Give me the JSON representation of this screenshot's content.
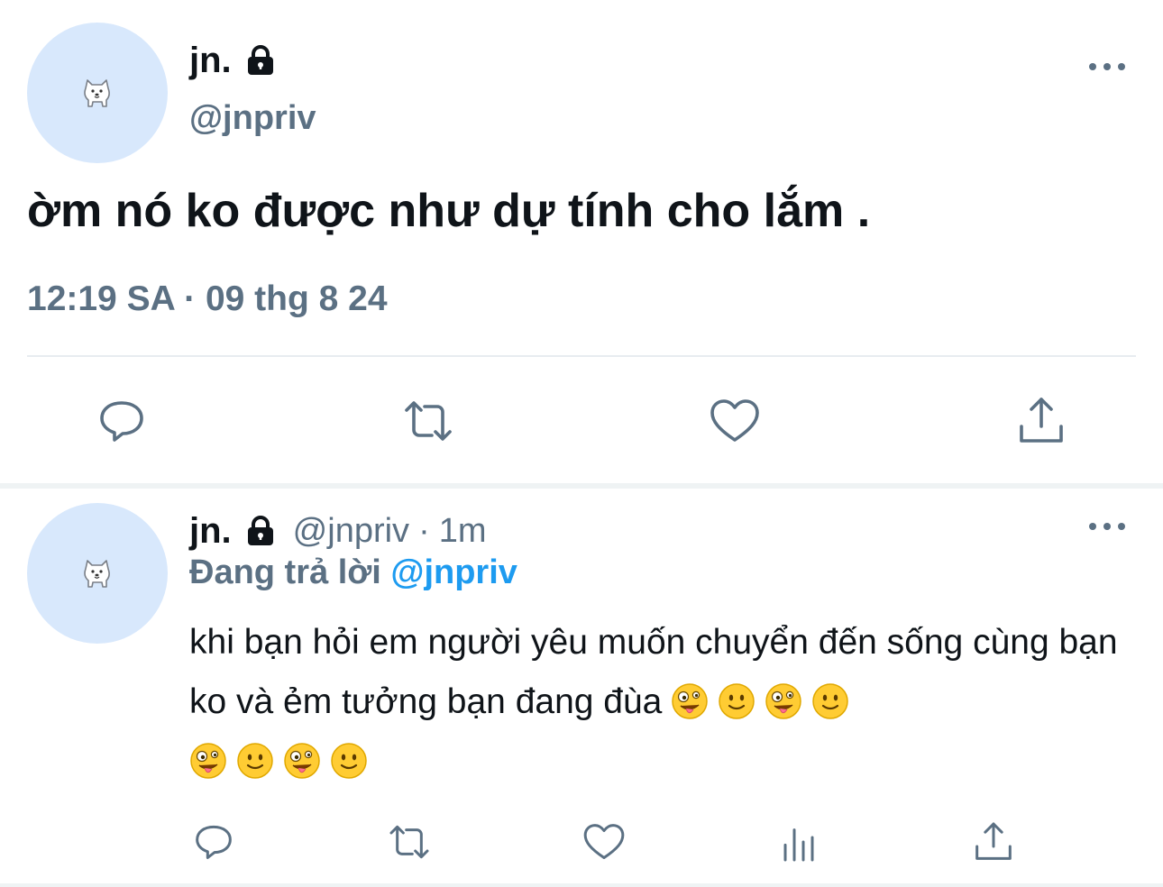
{
  "main_tweet": {
    "display_name": "jn.",
    "handle": "@jnpriv",
    "text": "ờm nó ko được như dự tính cho lắm .",
    "meta": "12:19 SA · 09 thg 8 24",
    "avatar_icon": "dog-avatar-icon",
    "lock_icon": "lock-icon",
    "actions": [
      "reply-icon",
      "retweet-icon",
      "like-icon",
      "share-icon"
    ]
  },
  "reply_tweet": {
    "display_name": "jn.",
    "handle": "@jnpriv",
    "separator": "·",
    "time": "1m",
    "replying_prefix": "Đang trả lời",
    "replying_mention": "@jnpriv",
    "text": "khi bạn hỏi em người yêu muốn chuyển đến sống cùng bạn ko và ẻm tưởng bạn đang đùa",
    "emojis": [
      "zany-face",
      "slightly-smiling-face",
      "zany-face",
      "slightly-smiling-face",
      "zany-face",
      "slightly-smiling-face",
      "zany-face",
      "slightly-smiling-face"
    ],
    "actions": [
      "reply-icon",
      "retweet-icon",
      "like-icon",
      "analytics-icon",
      "share-icon"
    ]
  },
  "colors": {
    "text_primary": "#0f1419",
    "text_secondary": "#5b7083",
    "accent": "#1d9bf0",
    "avatar_bg": "#d8e8fc",
    "divider": "#e7ecf0"
  }
}
